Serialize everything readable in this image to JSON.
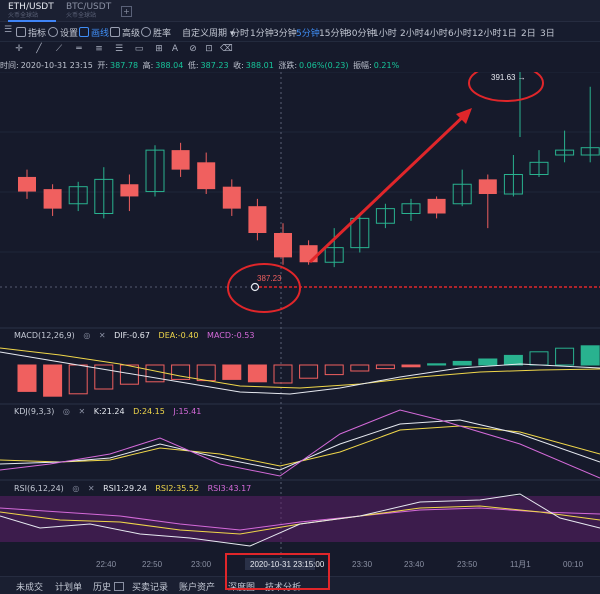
{
  "tabs": [
    {
      "pair": "ETH/USDT",
      "sub": "火币全球站"
    },
    {
      "pair": "BTC/USDT",
      "sub": "火币全球站"
    }
  ],
  "tab_add": "+",
  "toolbar": {
    "indicators": "指标",
    "settings": "设置",
    "draw": "画线",
    "advanced": "高级",
    "winrate": "胜率",
    "custom_period": "自定义周期"
  },
  "periods": [
    "分时",
    "1分钟",
    "3分钟",
    "5分钟",
    "15分钟",
    "30分钟",
    "1小时",
    "2小时",
    "4小时",
    "6小时",
    "12小时",
    "1日",
    "2日",
    "3日"
  ],
  "active_period": "5分钟",
  "info": {
    "time_label": "时间:",
    "time": "2020-10-31 23:15",
    "open_label": "开:",
    "open": "387.78",
    "high_label": "高:",
    "high": "388.04",
    "low_label": "低:",
    "low": "387.23",
    "close_label": "收:",
    "close": "388.01",
    "chg_label": "涨跌:",
    "chg": "0.06%(0.23)",
    "amp_label": "振幅:",
    "amp": "0.21%"
  },
  "annotations": {
    "high_price": "391.63 →",
    "low_price": "387.23"
  },
  "macd": {
    "name": "MACD(12,26,9)",
    "dif": "DIF:-0.67",
    "dea": "DEA:-0.40",
    "macd": "MACD:-0.53"
  },
  "kdj": {
    "name": "KDJ(9,3,3)",
    "k": "K:21.24",
    "d": "D:24.15",
    "j": "J:15.41"
  },
  "rsi": {
    "name": "RSI(6,12,24)",
    "rsi1": "RSI1:29.24",
    "rsi2": "RSI2:35.52",
    "rsi3": "RSI3:43.17"
  },
  "time_axis": {
    "ticks": [
      "22:40",
      "22:50",
      "23:00",
      "23:10",
      "23:20",
      "23:30",
      "23:40",
      "23:50",
      "11月1",
      "00:10"
    ],
    "crosshair_label": "2020-10-31 23:15:00"
  },
  "bottom_tabs": [
    "未成交",
    "计划单",
    "历史",
    "买卖记录",
    "账户资产",
    "深度图",
    "技术分析"
  ],
  "colors": {
    "up": "#29b28f",
    "down": "#f0605f",
    "accent": "#3f8ef6",
    "annotation": "#e0262a",
    "background": "#161a2b"
  },
  "chart_data": {
    "type": "candlestick",
    "candles": [
      {
        "o": 387.9,
        "c": 387.3,
        "h": 388.2,
        "l": 387.0
      },
      {
        "o": 387.4,
        "c": 386.6,
        "h": 387.6,
        "l": 386.3
      },
      {
        "o": 386.8,
        "c": 387.5,
        "h": 387.7,
        "l": 386.5
      },
      {
        "o": 386.4,
        "c": 387.8,
        "h": 388.3,
        "l": 386.2
      },
      {
        "o": 387.6,
        "c": 387.1,
        "h": 388.0,
        "l": 386.5
      },
      {
        "o": 387.3,
        "c": 389.0,
        "h": 389.2,
        "l": 387.1
      },
      {
        "o": 389.0,
        "c": 388.2,
        "h": 389.3,
        "l": 387.9
      },
      {
        "o": 388.5,
        "c": 387.4,
        "h": 388.9,
        "l": 387.2
      },
      {
        "o": 387.5,
        "c": 386.6,
        "h": 387.8,
        "l": 386.3
      },
      {
        "o": 386.7,
        "c": 385.6,
        "h": 387.0,
        "l": 385.3
      },
      {
        "o": 385.6,
        "c": 384.6,
        "h": 386.0,
        "l": 384.3
      },
      {
        "o": 385.1,
        "c": 384.4,
        "h": 385.3,
        "l": 384.3
      },
      {
        "o": 384.4,
        "c": 385.0,
        "h": 385.8,
        "l": 384.2
      },
      {
        "o": 385.0,
        "c": 386.2,
        "h": 386.4,
        "l": 384.8
      },
      {
        "o": 386.0,
        "c": 386.6,
        "h": 386.8,
        "l": 385.8
      },
      {
        "o": 386.4,
        "c": 386.8,
        "h": 387.0,
        "l": 386.1
      },
      {
        "o": 387.0,
        "c": 386.4,
        "h": 387.1,
        "l": 386.2
      },
      {
        "o": 386.8,
        "c": 387.6,
        "h": 388.2,
        "l": 386.7
      },
      {
        "o": 387.8,
        "c": 387.2,
        "h": 388.0,
        "l": 385.8
      },
      {
        "o": 387.2,
        "c": 388.0,
        "h": 388.8,
        "l": 387.1
      },
      {
        "o": 388.0,
        "c": 388.5,
        "h": 389.0,
        "l": 387.9
      },
      {
        "o": 388.8,
        "c": 389.0,
        "h": 389.8,
        "l": 388.5
      },
      {
        "o": 388.8,
        "c": 389.1,
        "h": 391.6,
        "l": 388.5
      },
      {
        "o": 389.1,
        "c": 387.8,
        "h": 389.3,
        "l": 387.5
      },
      {
        "o": 387.9,
        "c": 387.7,
        "h": 388.0,
        "l": 387.3
      },
      {
        "o": 387.8,
        "c": 387.0,
        "h": 388.4,
        "l": 386.8
      }
    ],
    "macd_bars": [
      -2.2,
      -2.6,
      -2.4,
      -2.0,
      -1.6,
      -1.4,
      -1.2,
      -1.3,
      -1.2,
      -1.4,
      -1.5,
      -1.1,
      -0.8,
      -0.5,
      -0.3,
      -0.15,
      0.1,
      0.3,
      0.5,
      0.8,
      1.1,
      1.4,
      1.6,
      1.4,
      1.1,
      0.7
    ],
    "macd_bars_filled": [
      true,
      true,
      false,
      false,
      false,
      false,
      false,
      false,
      true,
      true,
      false,
      false,
      false,
      false,
      false,
      true,
      true,
      true,
      true,
      true,
      false,
      false,
      true,
      true,
      true,
      true
    ]
  }
}
